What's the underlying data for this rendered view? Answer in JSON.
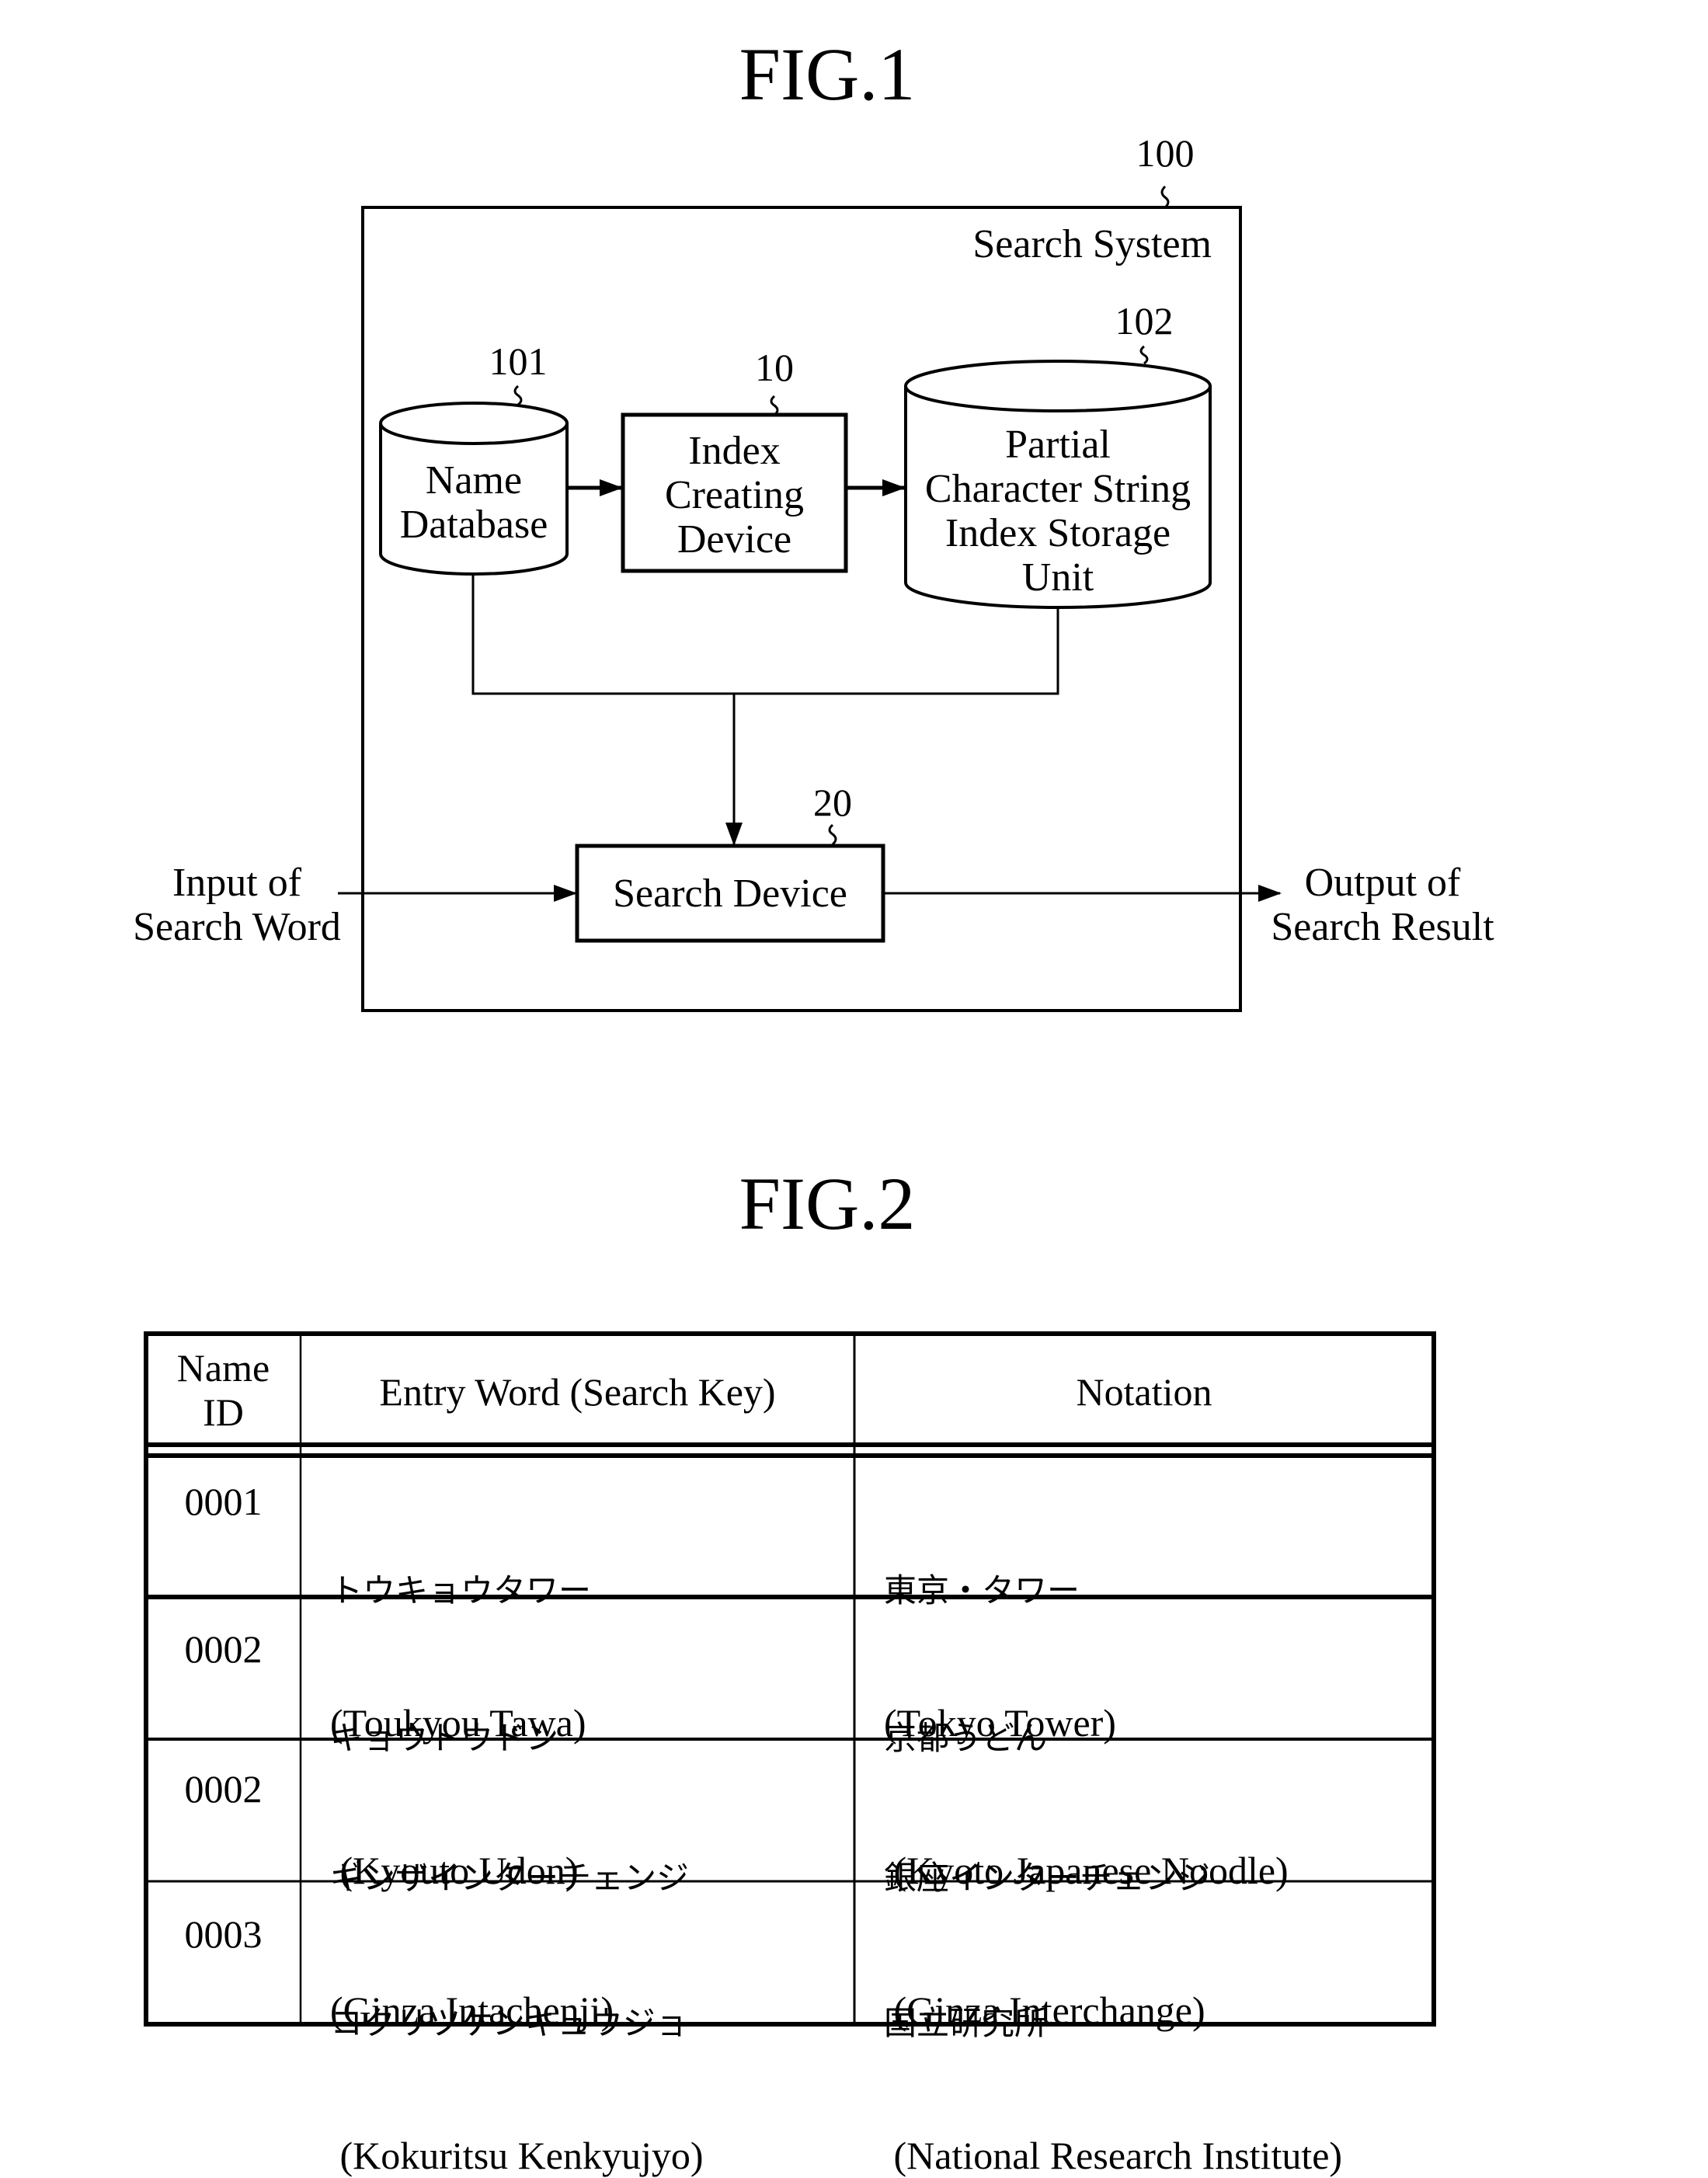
{
  "fig1": {
    "title": "FIG.1",
    "system": {
      "ref": "100",
      "label": "Search System"
    },
    "name_database": {
      "ref": "101",
      "line1": "Name",
      "line2": "Database"
    },
    "index_creating_device": {
      "ref": "10",
      "line1": "Index",
      "line2": "Creating",
      "line3": "Device"
    },
    "index_storage": {
      "ref": "102",
      "line1": "Partial",
      "line2": "Character String",
      "line3": "Index Storage",
      "line4": "Unit"
    },
    "search_device": {
      "ref": "20",
      "label": "Search Device"
    },
    "input": {
      "line1": "Input of",
      "line2": "Search Word"
    },
    "output": {
      "line1": "Output of",
      "line2": "Search Result"
    }
  },
  "fig2": {
    "title": "FIG.2",
    "headers": {
      "id_line1": "Name",
      "id_line2": "ID",
      "entry": "Entry Word (Search Key)",
      "notation": "Notation"
    },
    "rows": [
      {
        "id": "0001",
        "entry_kana": "トウキョウタワー",
        "entry_roman": "(Toukyou Tawa)",
        "notation_jp": "東京・タワー",
        "notation_en": "(Tokyo Tower)"
      },
      {
        "id": "0002",
        "entry_kana": "キョウトウドン",
        "entry_roman": " (Kyouto Udon)",
        "notation_jp": "京都うどん",
        "notation_en": " (Kyoto Japanese Noodle)"
      },
      {
        "id": "0002",
        "entry_kana": "ギンザインターチェンジ",
        "entry_roman": "(Ginza Intachenji)",
        "notation_jp": "銀座インターチェンジ",
        "notation_en": " (Ginza Interchange)"
      },
      {
        "id": "0003",
        "entry_kana": "コクリツケンキュウジョ",
        "entry_roman": " (Kokuritsu Kenkyujyo)",
        "notation_jp": "国立研究所",
        "notation_en": " (National Research Institute)"
      }
    ]
  }
}
